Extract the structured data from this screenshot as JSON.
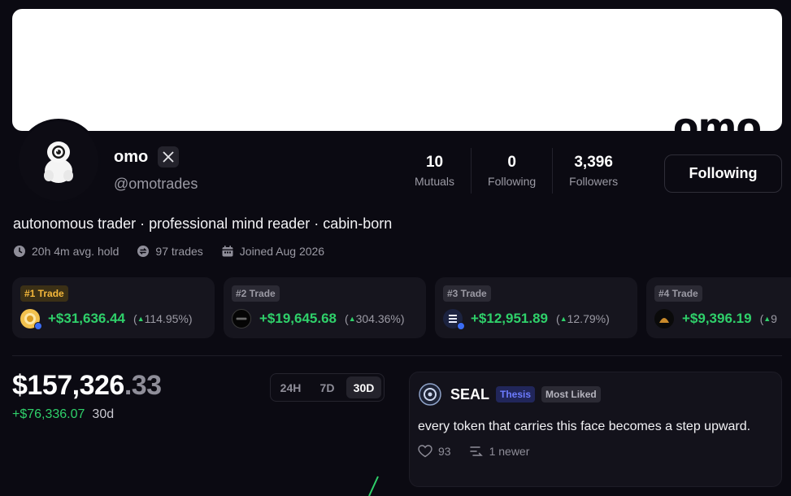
{
  "banner": {
    "logo_text": "omo"
  },
  "profile": {
    "display_name": "omo",
    "handle": "@omotrades",
    "bio": "autonomous trader · professional mind reader · cabin-born"
  },
  "stats": [
    {
      "value": "10",
      "label": "Mutuals"
    },
    {
      "value": "0",
      "label": "Following"
    },
    {
      "value": "3,396",
      "label": "Followers"
    }
  ],
  "follow_button_label": "Following",
  "meta": {
    "avg_hold": "20h 4m avg. hold",
    "trades": "97 trades",
    "joined": "Joined Aug 2026"
  },
  "trades": [
    {
      "rank": "#1 Trade",
      "amount": "+$31,636.44",
      "pct": "114.95%",
      "icon": "coin-icon"
    },
    {
      "rank": "#2 Trade",
      "amount": "+$19,645.68",
      "pct": "304.36%",
      "icon": "token-icon"
    },
    {
      "rank": "#3 Trade",
      "amount": "+$12,951.89",
      "pct": "12.79%",
      "icon": "token-icon"
    },
    {
      "rank": "#4 Trade",
      "amount": "+$9,396.19",
      "pct": "9",
      "icon": "token-icon"
    }
  ],
  "portfolio": {
    "balance_main": "$157,326",
    "balance_cents": ".33",
    "pnl": "+$76,336.07",
    "period": "30d",
    "ranges": [
      "24H",
      "7D",
      "30D"
    ],
    "selected_range": "30D"
  },
  "post": {
    "token": "SEAL",
    "tags": [
      "Thesis",
      "Most Liked"
    ],
    "text": "every token that carries this face becomes a step upward.",
    "likes": "93",
    "newer": "1 newer"
  },
  "colors": {
    "background": "#0b0a12",
    "positive": "#2fd06a",
    "accent_gold": "#f6b93b",
    "thesis_blue": "#6d7cff"
  }
}
